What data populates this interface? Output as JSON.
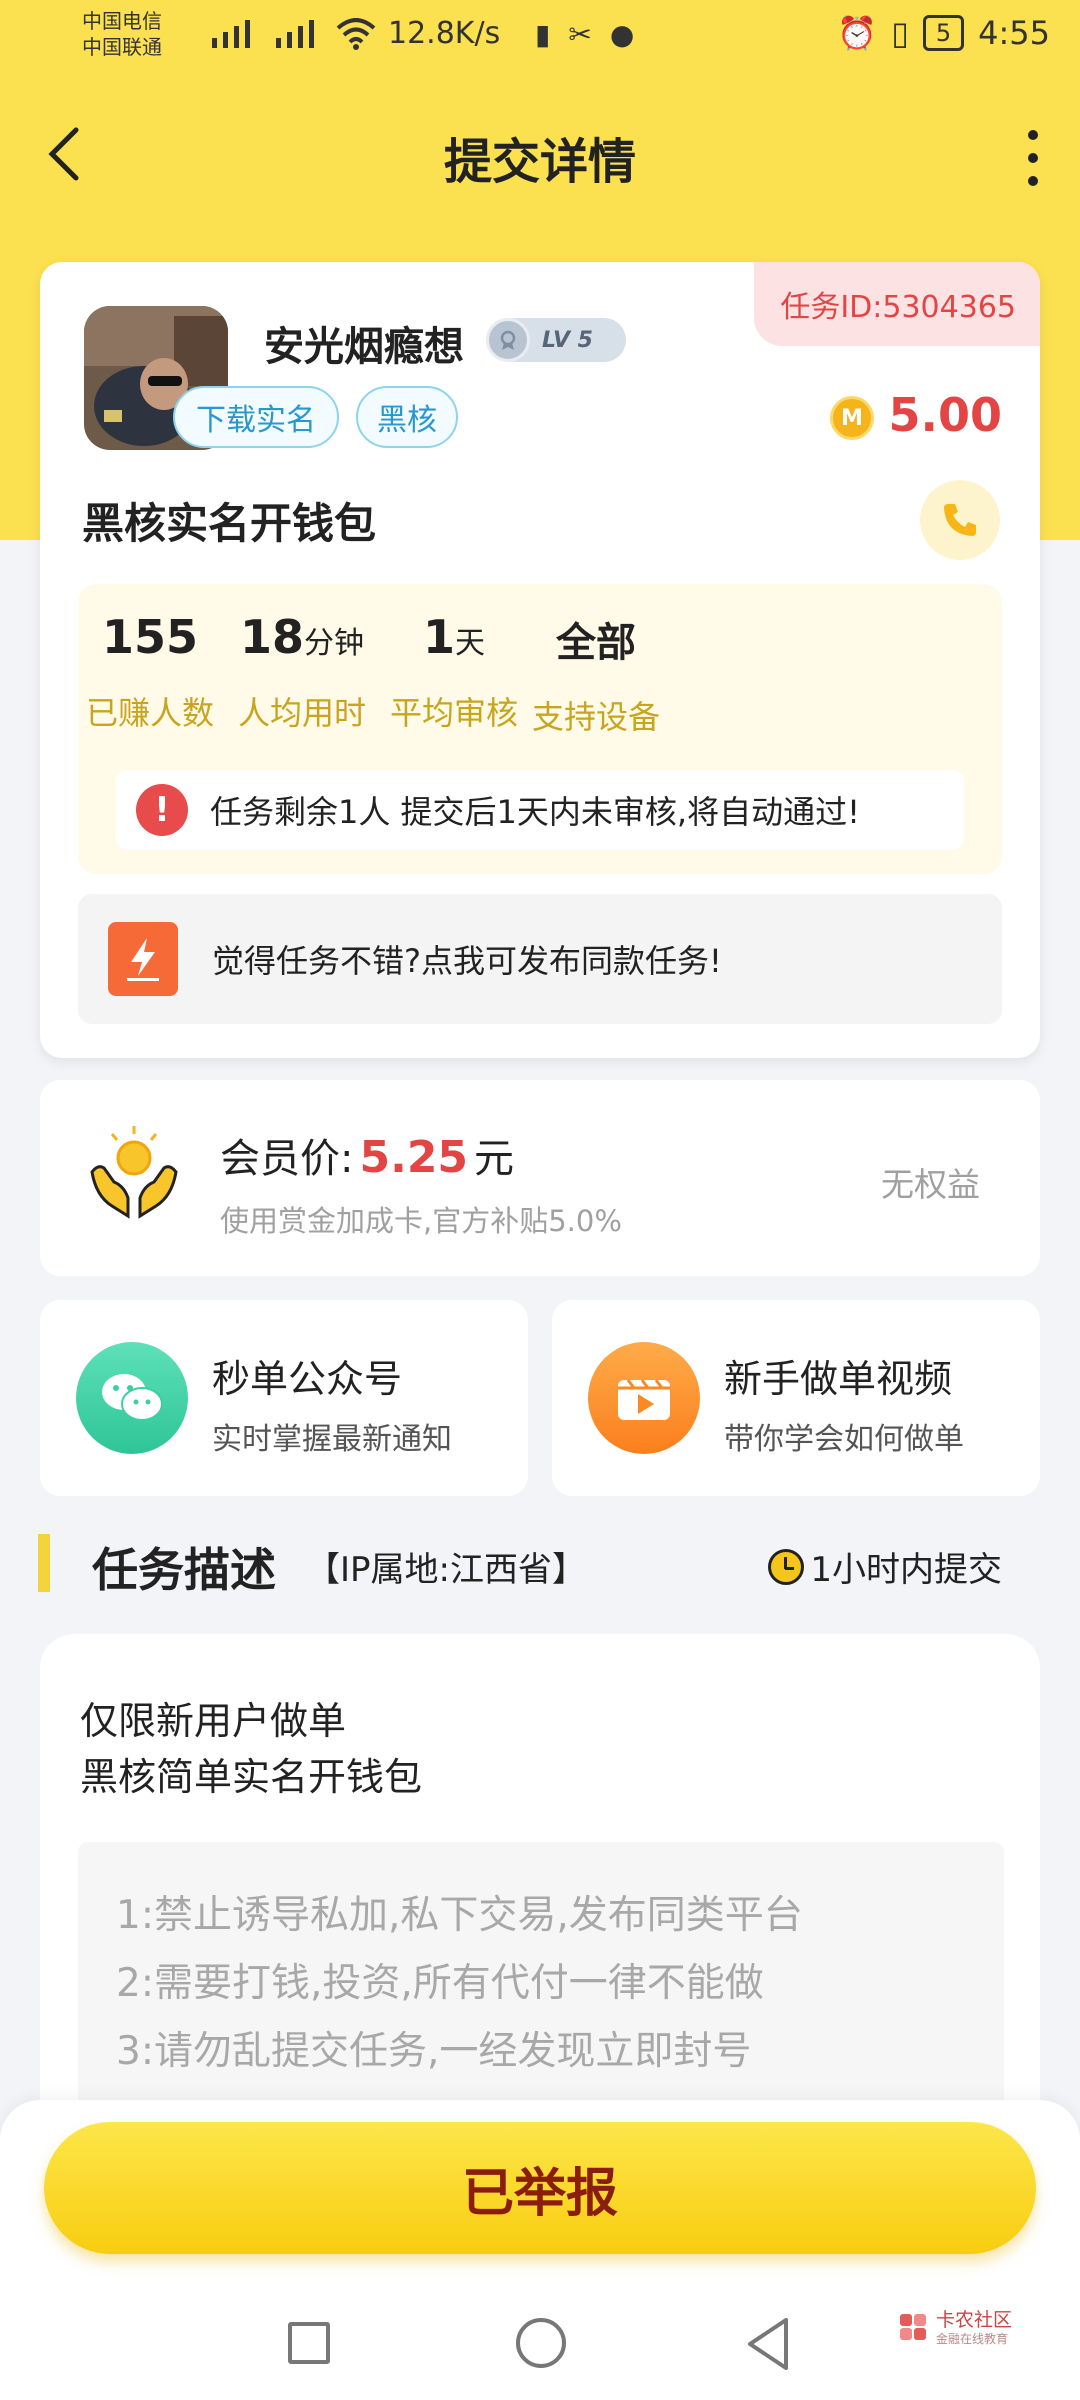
{
  "status_bar": {
    "carrier1": "中国电信",
    "carrier2": "中国联通",
    "speed": "12.8K/s",
    "battery": "5",
    "time": "4:55"
  },
  "header": {
    "title": "提交详情"
  },
  "task": {
    "id_label": "任务ID:5304365",
    "username": "安光烟瘾想",
    "level": "LV 5",
    "tags": [
      "下载实名",
      "黑核"
    ],
    "price": "5.00",
    "name": "黑核实名开钱包",
    "stats": [
      {
        "value": "155",
        "unit": "",
        "label": "已赚人数"
      },
      {
        "value": "18",
        "unit": "分钟",
        "label": "人均用时"
      },
      {
        "value": "1",
        "unit": "天",
        "label": "平均审核"
      },
      {
        "value": "全部",
        "unit": "",
        "label": "支持设备"
      }
    ],
    "notice": "任务剩余1人  提交后1天内未审核,将自动通过!",
    "publish_prompt": "觉得任务不错?点我可发布同款任务!"
  },
  "member": {
    "label": "会员价:",
    "price": "5.25",
    "unit": "元",
    "subtitle": "使用赏金加成卡,官方补贴5.0%",
    "status": "无权益"
  },
  "promos": [
    {
      "title": "秒单公众号",
      "subtitle": "实时掌握最新通知",
      "color": "#3ccfa4"
    },
    {
      "title": "新手做单视频",
      "subtitle": "带你学会如何做单",
      "color": "#fb8a25"
    }
  ],
  "description": {
    "title": "任务描述",
    "ip": "【IP属地:江西省】",
    "deadline": "1小时内提交",
    "lines": [
      "仅限新用户做单",
      "黑核简单实名开钱包"
    ],
    "rules": [
      "1:禁止诱导私加,私下交易,发布同类平台",
      "2:需要打钱,投资,所有代付一律不能做",
      "3:请勿乱提交任务,一经发现立即封号"
    ]
  },
  "action": {
    "label": "已举报"
  },
  "watermark": {
    "title": "卡农社区",
    "subtitle": "金融在线教育"
  },
  "colors": {
    "header": "#fbe04f",
    "price_red": "#e34545",
    "accent_gold": "#c9a41e"
  }
}
